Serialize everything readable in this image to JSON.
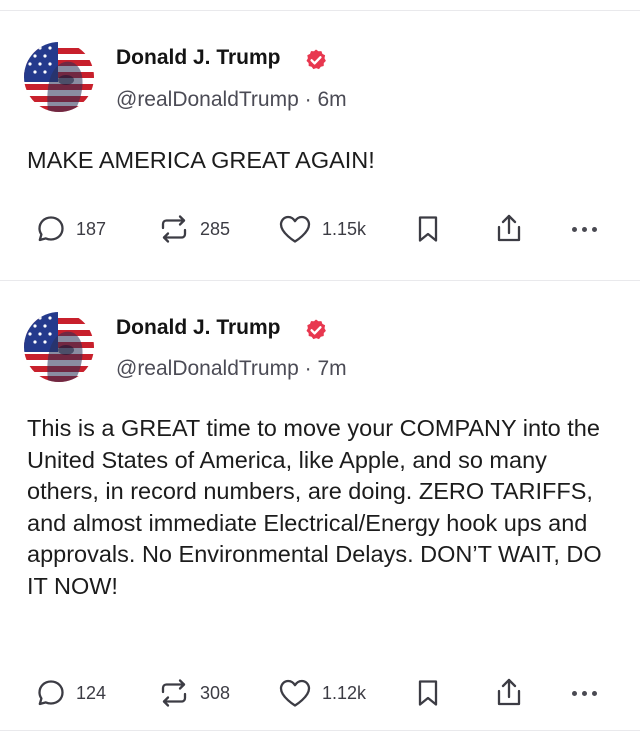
{
  "posts": [
    {
      "author": "Donald J. Trump",
      "handle": "@realDonaldTrump",
      "time": "6m",
      "text": "MAKE AMERICA GREAT AGAIN!",
      "replies": "187",
      "reposts": "285",
      "likes": "1.15k"
    },
    {
      "author": "Donald J. Trump",
      "handle": "@realDonaldTrump",
      "time": "7m",
      "text": "This is a GREAT time to move your COMPANY into the United States of America, like Apple, and so many others, in record numbers, are doing. ZERO TARIFFS, and almost immediate Electrical/Energy hook ups and approvals. No Environmental Delays. DON’T WAIT, DO IT NOW!",
      "replies": "124",
      "reposts": "308",
      "likes": "1.12k"
    }
  ],
  "separator": "·",
  "colors": {
    "verified": "#e8374f",
    "text": "#1c1c1c",
    "muted": "#4b4b55",
    "divider": "#e9e9ec"
  },
  "icons": [
    "verified-badge-icon",
    "reply-icon",
    "repost-icon",
    "like-icon",
    "bookmark-icon",
    "share-icon",
    "more-icon"
  ]
}
